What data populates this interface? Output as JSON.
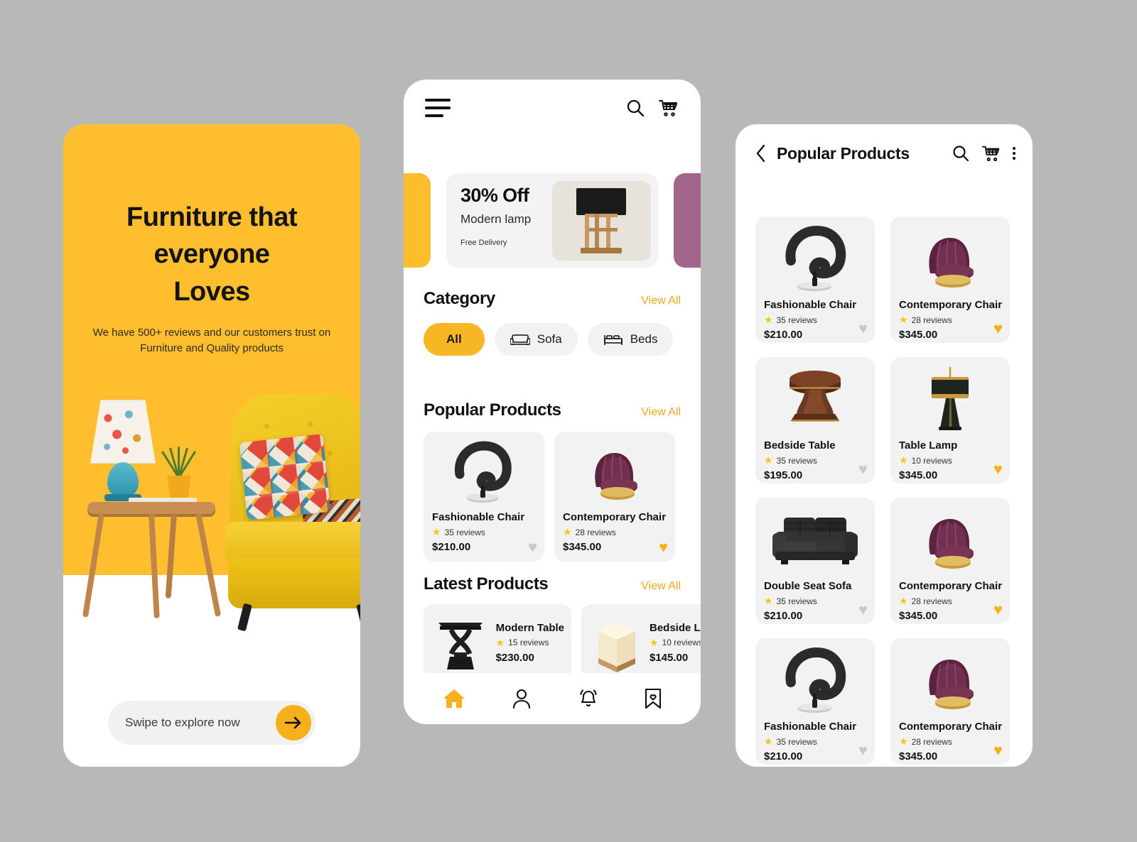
{
  "background_color": "#b8b8b8",
  "accent_yellow": "#F7B623",
  "accent_purple": "#A2658B",
  "onboarding": {
    "headline_line1": "Furniture that",
    "headline_line2": "everyone",
    "headline_line3": "Loves",
    "subtext": "We have 500+ reviews and our customers trust on Furniture and Quality products",
    "swipe_label": "Swipe to explore now",
    "arrow_icon": "arrow-right-icon"
  },
  "home": {
    "menu_icon": "hamburger-menu-icon",
    "search_icon": "search-icon",
    "cart_icon": "shopping-cart-icon",
    "promo": {
      "discount": "30% Off",
      "product": "Modern lamp",
      "delivery": "Free Delivery"
    },
    "category": {
      "title": "Category",
      "view_all": "View All",
      "chips": [
        {
          "label": "All",
          "icon": "",
          "active": true
        },
        {
          "label": "Sofa",
          "icon": "sofa-icon",
          "active": false
        },
        {
          "label": "Beds",
          "icon": "bed-icon",
          "active": false
        }
      ]
    },
    "popular": {
      "title": "Popular Products",
      "view_all": "View All",
      "items": [
        {
          "name": "Fashionable Chair",
          "reviews": "35 reviews",
          "price": "$210.00",
          "favorite": false,
          "image": "black-swivel-chair"
        },
        {
          "name": "Contemporary Chair",
          "reviews": "28 reviews",
          "price": "$345.00",
          "favorite": true,
          "image": "purple-velvet-chair"
        }
      ]
    },
    "latest": {
      "title": "Latest Products",
      "view_all": "View All",
      "items": [
        {
          "name": "Modern Table",
          "reviews": "15 reviews",
          "price": "$230.00",
          "image": "black-side-table"
        },
        {
          "name": "Bedside Lamp",
          "reviews": "10 reviews",
          "price": "$145.00",
          "image": "cube-lamp"
        }
      ]
    },
    "nav": [
      {
        "icon": "home-icon",
        "active": true
      },
      {
        "icon": "person-icon",
        "active": false
      },
      {
        "icon": "bell-icon",
        "active": false
      },
      {
        "icon": "bookmark-heart-icon",
        "active": false
      }
    ]
  },
  "popular_page": {
    "back_icon": "chevron-left-icon",
    "title": "Popular Products",
    "search_icon": "search-icon",
    "cart_icon": "shopping-cart-icon",
    "more_icon": "more-vertical-icon",
    "products": [
      {
        "name": "Fashionable Chair",
        "reviews": "35 reviews",
        "price": "$210.00",
        "favorite": false,
        "image": "black-swivel-chair"
      },
      {
        "name": "Contemporary Chair",
        "reviews": "28 reviews",
        "price": "$345.00",
        "favorite": true,
        "image": "purple-velvet-chair"
      },
      {
        "name": "Bedside Table",
        "reviews": "35 reviews",
        "price": "$195.00",
        "favorite": false,
        "image": "wood-pedestal-table"
      },
      {
        "name": "Table Lamp",
        "reviews": "10 reviews",
        "price": "$345.00",
        "favorite": true,
        "image": "black-gold-table-lamp"
      },
      {
        "name": "Double Seat Sofa",
        "reviews": "35 reviews",
        "price": "$210.00",
        "favorite": false,
        "image": "black-leather-sofa"
      },
      {
        "name": "Contemporary Chair",
        "reviews": "28 reviews",
        "price": "$345.00",
        "favorite": true,
        "image": "purple-velvet-chair"
      },
      {
        "name": "Fashionable Chair",
        "reviews": "35 reviews",
        "price": "$210.00",
        "favorite": false,
        "image": "black-swivel-chair"
      },
      {
        "name": "Contemporary Chair",
        "reviews": "28 reviews",
        "price": "$345.00",
        "favorite": true,
        "image": "purple-velvet-chair"
      }
    ]
  },
  "star_glyph": "★",
  "heart_glyph": "♥"
}
